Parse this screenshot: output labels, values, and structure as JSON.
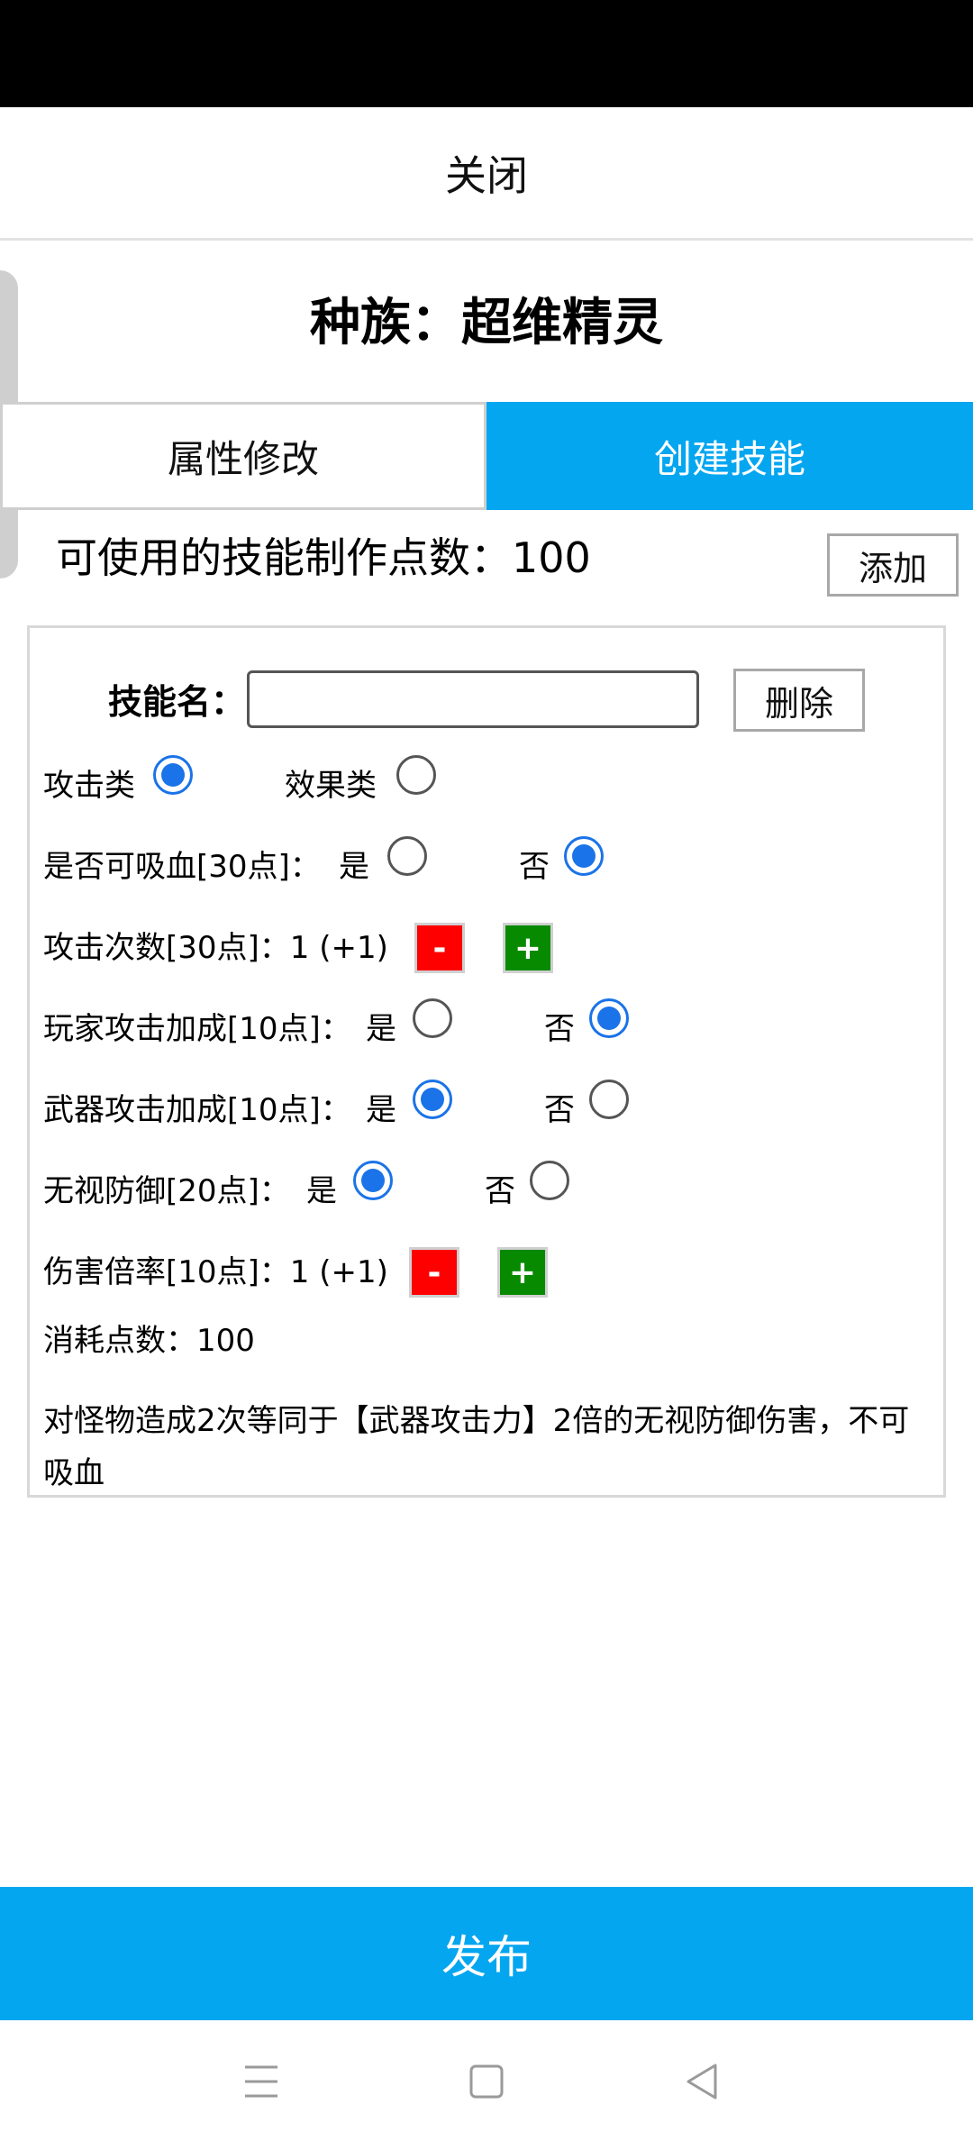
{
  "close_label": "关闭",
  "race_title": "种族：超维精灵",
  "tabs": [
    {
      "label": "属性修改",
      "active": false
    },
    {
      "label": "创建技能",
      "active": true
    }
  ],
  "points": {
    "label": "可使用的技能制作点数：",
    "value": "100",
    "add_label": "添加"
  },
  "skill": {
    "name_label": "技能名：",
    "name_value": "",
    "delete_label": "删除",
    "type": {
      "attack_label": "攻击类",
      "effect_label": "效果类",
      "selected": "attack"
    },
    "lifesteal": {
      "label": "是否可吸血[30点]：",
      "yes": "是",
      "no": "否",
      "selected": "no"
    },
    "attack_count": {
      "label": "攻击次数[30点]：",
      "value": "1 (+1)",
      "minus": "-",
      "plus": "+"
    },
    "player_attack": {
      "label": "玩家攻击加成[10点]：",
      "yes": "是",
      "no": "否",
      "selected": "no"
    },
    "weapon_attack": {
      "label": "武器攻击加成[10点]：",
      "yes": "是",
      "no": "否",
      "selected": "yes"
    },
    "ignore_defense": {
      "label": "无视防御[20点]：",
      "yes": "是",
      "no": "否",
      "selected": "yes"
    },
    "damage_ratio": {
      "label": "伤害倍率[10点]：",
      "value": "1 (+1)",
      "minus": "-",
      "plus": "+"
    },
    "cost": {
      "label": "消耗点数：",
      "value": "100"
    },
    "description": "对怪物造成2次等同于【武器攻击力】2倍的无视防御伤害，不可吸血"
  },
  "publish_label": "发布",
  "colors": {
    "accent": "#05a6f0",
    "radio_checked": "#1a73e8",
    "minus": "#ff0000",
    "plus": "#078a00"
  },
  "nav_icons": [
    "menu-icon",
    "home-square-icon",
    "back-triangle-icon"
  ]
}
